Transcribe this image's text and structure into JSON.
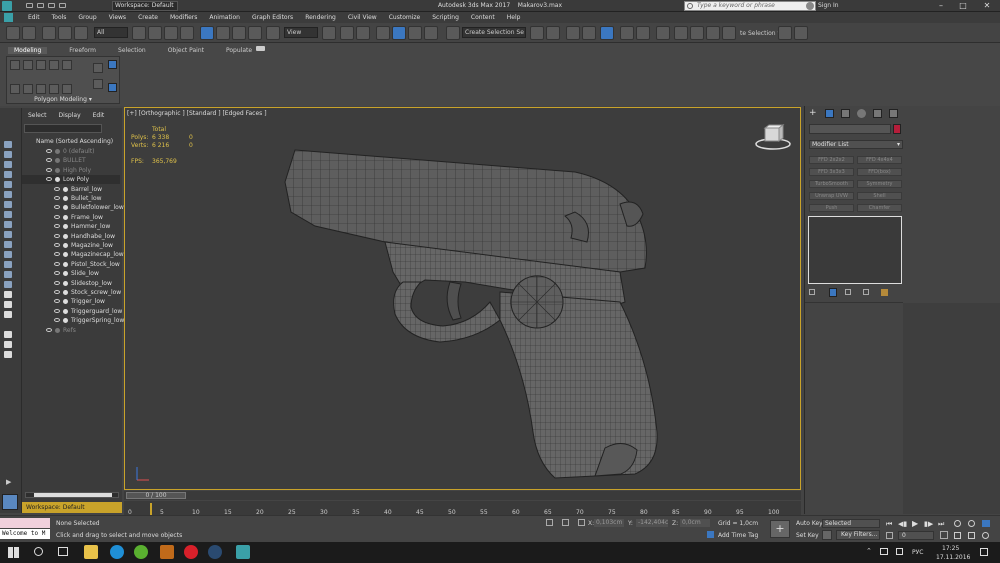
{
  "titlebar": {
    "workspace": "Workspace: Default",
    "app_title": "Autodesk 3ds Max 2017",
    "file_name": "Makarov3.max",
    "search_placeholder": "Type a keyword or phrase",
    "sign_in": "Sign In"
  },
  "menu": [
    "Edit",
    "Tools",
    "Group",
    "Views",
    "Create",
    "Modifiers",
    "Animation",
    "Graph Editors",
    "Rendering",
    "Civil View",
    "Customize",
    "Scripting",
    "Content",
    "Help"
  ],
  "toolbar": {
    "filter": "All",
    "coord_system": "View",
    "selection_set": "Create Selection Se",
    "selection_set_right": "te Selection %"
  },
  "ribbon": {
    "tabs": [
      "Modeling",
      "Freeform",
      "Selection",
      "Object Paint",
      "Populate"
    ],
    "panel_label": "Polygon Modeling"
  },
  "explorer": {
    "tabs": [
      "Select",
      "Display",
      "Edit"
    ],
    "header": "Name (Sorted Ascending)",
    "items": [
      {
        "label": "0 (default)",
        "indent": 0,
        "dim": true
      },
      {
        "label": "BULLET",
        "indent": 0,
        "dim": true
      },
      {
        "label": "High Poly",
        "indent": 0,
        "dim": true
      },
      {
        "label": "Low Poly",
        "indent": 0,
        "dim": false
      },
      {
        "label": "Barrel_low",
        "indent": 1,
        "dim": false
      },
      {
        "label": "Bullet_low",
        "indent": 1,
        "dim": false
      },
      {
        "label": "Bulletfolower_low",
        "indent": 1,
        "dim": false
      },
      {
        "label": "Frame_low",
        "indent": 1,
        "dim": false
      },
      {
        "label": "Hammer_low",
        "indent": 1,
        "dim": false
      },
      {
        "label": "Handhabe_low",
        "indent": 1,
        "dim": false
      },
      {
        "label": "Magazine_low",
        "indent": 1,
        "dim": false
      },
      {
        "label": "Magazinecap_low",
        "indent": 1,
        "dim": false
      },
      {
        "label": "Pistol_Stock_low",
        "indent": 1,
        "dim": false
      },
      {
        "label": "Slide_low",
        "indent": 1,
        "dim": false
      },
      {
        "label": "Slidestop_low",
        "indent": 1,
        "dim": false
      },
      {
        "label": "Stock_screw_low",
        "indent": 1,
        "dim": false
      },
      {
        "label": "Trigger_low",
        "indent": 1,
        "dim": false
      },
      {
        "label": "Triggerguard_low",
        "indent": 1,
        "dim": false
      },
      {
        "label": "TriggerSpring_low",
        "indent": 1,
        "dim": false
      },
      {
        "label": "Refs",
        "indent": 0,
        "dim": true
      }
    ],
    "workspace": "Workspace: Default"
  },
  "viewport": {
    "label": "[+] [Orthographic ] [Standard ] [Edged Faces ]",
    "stats": {
      "total_label": "Total",
      "polys_label": "Polys:",
      "polys_total": "6 338",
      "polys_sel": "0",
      "verts_label": "Verts:",
      "verts_total": "6 216",
      "verts_sel": "0",
      "fps_label": "FPS:",
      "fps_value": "365,769"
    }
  },
  "command_panel": {
    "modifier_list": "Modifier List",
    "buttons": [
      "FFD 2x2x2",
      "FFD 4x4x4",
      "FFD 3x3x3",
      "FFD(box)",
      "TurboSmooth",
      "Symmetry",
      "Unwrap UVW",
      "Shell",
      "Push",
      "Chamfer"
    ]
  },
  "timeline": {
    "frame": "0 / 100",
    "ticks": [
      "0",
      "5",
      "10",
      "15",
      "20",
      "25",
      "30",
      "35",
      "40",
      "45",
      "50",
      "55",
      "60",
      "65",
      "70",
      "75",
      "80",
      "85",
      "90",
      "95",
      "100"
    ]
  },
  "status": {
    "maxscript": "Welcome to M",
    "selection": "None Selected",
    "prompt": "Click and drag to select and move objects",
    "x_label": "X:",
    "x_value": "0,103cm",
    "y_label": "Y:",
    "y_value": "-142,404c",
    "z_label": "Z:",
    "z_value": "0,0cm",
    "grid": "Grid = 1,0cm",
    "add_time_tag": "Add Time Tag",
    "auto_key": "Auto Key",
    "selected": "Selected",
    "set_key": "Set Key",
    "key_filters": "Key Filters...",
    "frame_value": "0"
  },
  "taskbar": {
    "lang": "РУС",
    "time": "17:25",
    "date": "17.11.2016"
  },
  "colors": {
    "viewport_border": "#c9a32a",
    "stats_text": "#e0c24a",
    "accent": "#3b77c0"
  }
}
